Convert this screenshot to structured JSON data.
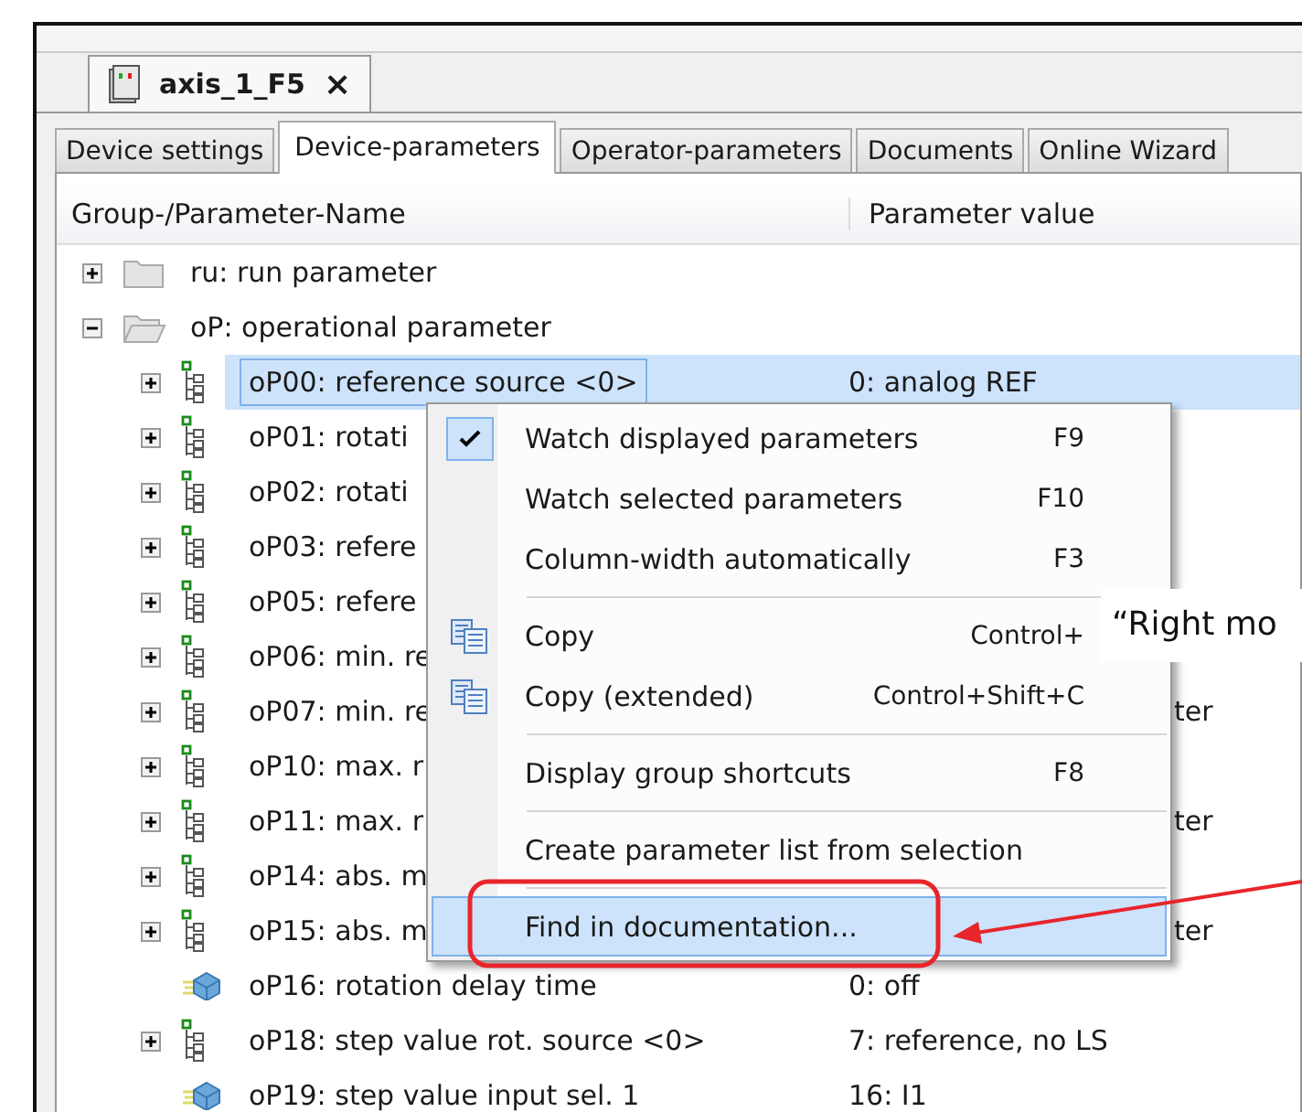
{
  "document_tab": {
    "title": "axis_1_F5",
    "close": "×"
  },
  "tabs": [
    {
      "label": "Device settings",
      "selected": false
    },
    {
      "label": "Device-parameters",
      "selected": true
    },
    {
      "label": "Operator-parameters",
      "selected": false
    },
    {
      "label": "Documents",
      "selected": false
    },
    {
      "label": "Online Wizard",
      "selected": false
    }
  ],
  "table": {
    "columns": [
      "Group-/Parameter-Name",
      "Parameter value"
    ],
    "rows": [
      {
        "kind": "group",
        "name": "ru: run parameter",
        "expanded": false,
        "selected": false
      },
      {
        "kind": "group",
        "name": "oP: operational parameter",
        "expanded": true,
        "selected": false,
        "children": [
          {
            "kind": "param-group",
            "name": "oP00: reference source <0>",
            "value": "0: analog REF",
            "expanded": false,
            "selected": true
          },
          {
            "kind": "param-group",
            "name": "oP01: rotati",
            "expanded": false,
            "selected": false
          },
          {
            "kind": "param-group",
            "name": "oP02: rotati",
            "expanded": false,
            "selected": false
          },
          {
            "kind": "param-group",
            "name": "oP03: refere",
            "expanded": false,
            "selected": false
          },
          {
            "kind": "param-group",
            "name": "oP05: refere",
            "expanded": false,
            "selected": false
          },
          {
            "kind": "param-group",
            "name": "oP06: min. re",
            "expanded": false,
            "selected": false
          },
          {
            "kind": "param-group",
            "name": "oP07: min. re",
            "value": "ter",
            "covered": true,
            "expanded": false,
            "selected": false
          },
          {
            "kind": "param-group",
            "name": "oP10: max. r",
            "expanded": false,
            "selected": false
          },
          {
            "kind": "param-group",
            "name": "oP11: max. r",
            "value": "ter",
            "covered": true,
            "expanded": false,
            "selected": false
          },
          {
            "kind": "param-group",
            "name": "oP14: abs. m",
            "expanded": false,
            "selected": false
          },
          {
            "kind": "param-group",
            "name": "oP15: abs. m",
            "value": "ter",
            "covered": true,
            "expanded": false,
            "selected": false
          },
          {
            "kind": "param",
            "name": "oP16: rotation delay time",
            "value": "0: off",
            "selected": false
          },
          {
            "kind": "param-group",
            "name": "oP18: step value rot. source <0>",
            "value": "7: reference, no LS",
            "expanded": false,
            "selected": false
          },
          {
            "kind": "param",
            "name": "oP19: step value input sel. 1",
            "value": "16: I1",
            "selected": false
          }
        ]
      }
    ]
  },
  "context_menu": {
    "items": [
      {
        "kind": "check",
        "label": "Watch displayed parameters",
        "shortcut": "F9",
        "checked": true,
        "selected": false
      },
      {
        "kind": "plain",
        "label": "Watch selected parameters",
        "shortcut": "F10",
        "selected": false
      },
      {
        "kind": "plain",
        "label": "Column-width automatically",
        "shortcut": "F3",
        "selected": false
      },
      {
        "kind": "separator"
      },
      {
        "kind": "copy",
        "label": "Copy",
        "shortcut": "Control+",
        "selected": false
      },
      {
        "kind": "copy",
        "label": "Copy (extended)",
        "shortcut": "Control+Shift+C",
        "selected": false
      },
      {
        "kind": "separator"
      },
      {
        "kind": "plain",
        "label": "Display group shortcuts",
        "shortcut": "F8",
        "selected": false
      },
      {
        "kind": "separator"
      },
      {
        "kind": "plain",
        "label": "Create parameter list from selection",
        "selected": false
      },
      {
        "kind": "separator"
      },
      {
        "kind": "plain",
        "label": "Find in documentation...",
        "selected": true
      }
    ]
  },
  "annotation": {
    "text": "“Right mo"
  }
}
